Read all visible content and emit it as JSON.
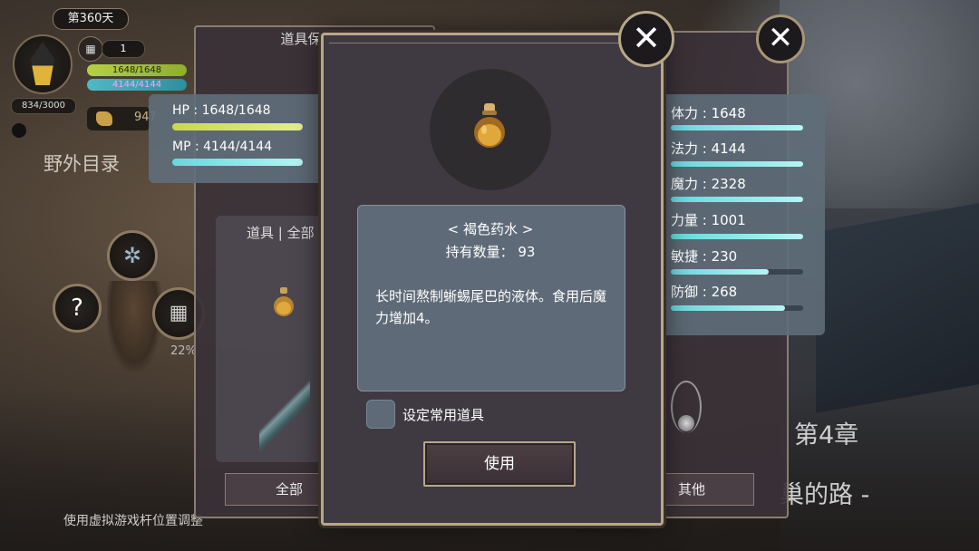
{
  "hud": {
    "day": "第360天",
    "crystal_count": "834/3000",
    "level": "1",
    "hp_mini": "1648/1648",
    "mp_mini": "4144/4144",
    "gold": "947",
    "field_title": "野外目录",
    "percent": "22%",
    "hint": "使用虚拟游戏杆位置调整"
  },
  "storage": {
    "title": "道具保管箱",
    "hp": "HP : 1648/1648",
    "mp": "MP : 4144/4144",
    "items_label": "道具 | 全部",
    "all_button": "全部",
    "other_button": "其他"
  },
  "stats": [
    {
      "label": "体力 : 1648",
      "fraction": 1.0
    },
    {
      "label": "法力 : 4144",
      "fraction": 1.0
    },
    {
      "label": "魔力 : 2328",
      "fraction": 1.0
    },
    {
      "label": "力量 : 1001",
      "fraction": 1.0
    },
    {
      "label": "敏捷 : 230",
      "fraction": 0.74
    },
    {
      "label": "防御 : 268",
      "fraction": 0.86
    }
  ],
  "item": {
    "name": "< 褐色药水 >",
    "count": "持有数量： 93",
    "description": "长时间熬制蜥蜴尾巴的液体。食用后魔力增加4。",
    "set_common": "设定常用道具",
    "use_button": "使用"
  },
  "background": {
    "chapter": "第4章",
    "road": "巢的路 -"
  },
  "colors": {
    "hp_bar": "#d4e35a",
    "mp_bar": "#7fe4ea",
    "stat_bar": "#8ce6ea",
    "modal_border": "#b9a789",
    "desc_box": "#5f6a78"
  }
}
